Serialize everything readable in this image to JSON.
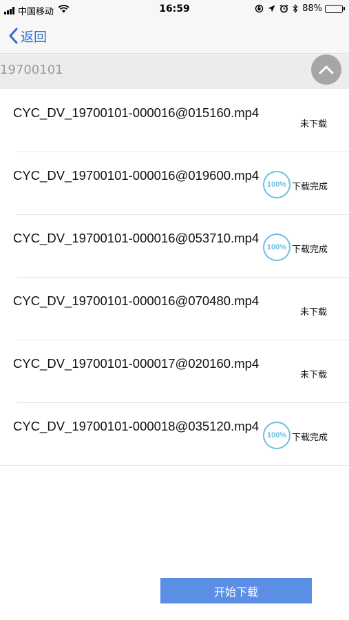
{
  "status_bar": {
    "carrier": "中国移动",
    "time": "16:59",
    "battery_percent": "88%",
    "battery_level": 0.88,
    "icons": [
      "signal-icon",
      "wifi-icon",
      "lock-rotation-icon",
      "location-icon",
      "alarm-icon",
      "bluetooth-icon",
      "battery-icon"
    ]
  },
  "nav": {
    "back_label": "返回"
  },
  "date_header": {
    "label": "19700101"
  },
  "files": [
    {
      "name": "CYC_DV_19700101-000016@015160.mp4",
      "status": "未下载",
      "progress": ""
    },
    {
      "name": "CYC_DV_19700101-000016@019600.mp4",
      "status": "下载完成",
      "progress": "100%"
    },
    {
      "name": "CYC_DV_19700101-000016@053710.mp4",
      "status": "下载完成",
      "progress": "100%"
    },
    {
      "name": "CYC_DV_19700101-000016@070480.mp4",
      "status": "未下载",
      "progress": ""
    },
    {
      "name": "CYC_DV_19700101-000017@020160.mp4",
      "status": "未下载",
      "progress": ""
    },
    {
      "name": "CYC_DV_19700101-000018@035120.mp4",
      "status": "下载完成",
      "progress": "100%"
    }
  ],
  "actions": {
    "start_download_label": "开始下载"
  },
  "colors": {
    "accent": "#2f6fd0",
    "button": "#5b8fe6",
    "progress": "#6bbfe0",
    "header_bg": "#ececee"
  }
}
